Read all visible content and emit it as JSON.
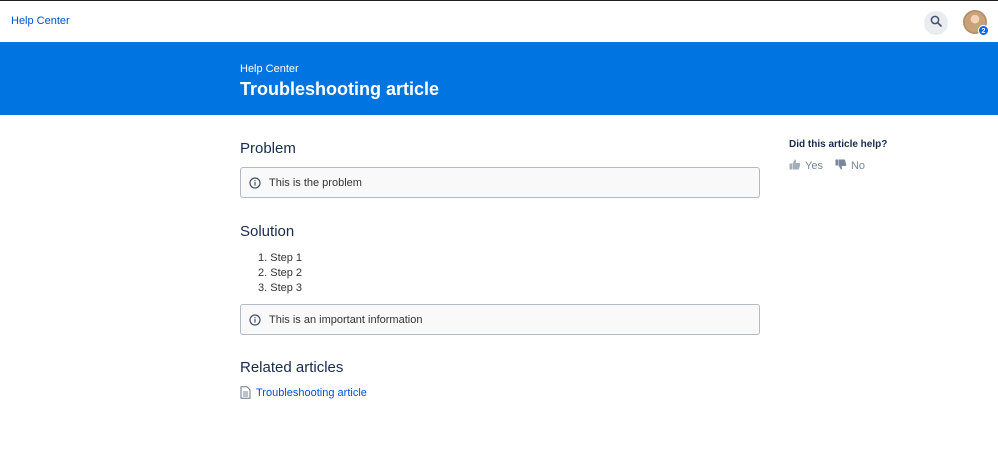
{
  "topbar": {
    "brand": "Help Center",
    "search_icon": "search-icon",
    "avatar_badge": "2"
  },
  "hero": {
    "breadcrumb": "Help Center",
    "title": "Troubleshooting article"
  },
  "problem": {
    "heading": "Problem",
    "panel_text": "This is the problem",
    "panel_icon": "info-icon"
  },
  "solution": {
    "heading": "Solution",
    "steps": [
      "Step 1",
      "Step 2",
      "Step 3"
    ],
    "panel_text": "This is an important information",
    "panel_icon": "info-icon"
  },
  "related": {
    "heading": "Related articles",
    "links": [
      {
        "label": "Troubleshooting article",
        "icon": "document-icon"
      }
    ]
  },
  "feedback": {
    "title": "Did this article help?",
    "yes_label": "Yes",
    "no_label": "No"
  },
  "colors": {
    "hero_bg": "#0074e0",
    "link": "#0052cc",
    "heading": "#172b4d"
  }
}
